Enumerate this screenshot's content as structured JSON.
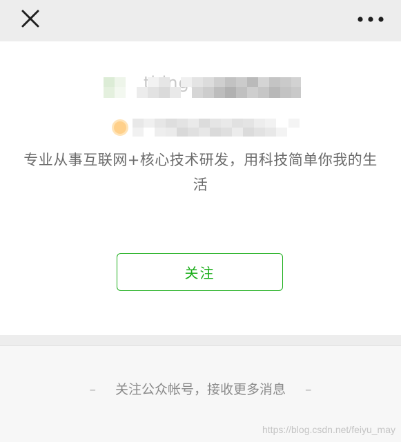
{
  "nav": {
    "close_icon": "close-icon",
    "more_icon": "more-options-icon"
  },
  "profile": {
    "name_visible": "thingoo",
    "description": "专业从事互联网+核心技术研发，用科技简单你我的生活"
  },
  "actions": {
    "follow_label": "关注"
  },
  "footer": {
    "dash_left": "–",
    "hint": "关注公众帐号，接收更多消息",
    "dash_right": "–"
  },
  "watermark": "https://blog.csdn.net/feiyu_may",
  "colors": {
    "accent_green": "#1aad19",
    "nav_bg": "#ededed",
    "card_bg": "#ffffff",
    "footer_bg": "#f7f7f7"
  }
}
